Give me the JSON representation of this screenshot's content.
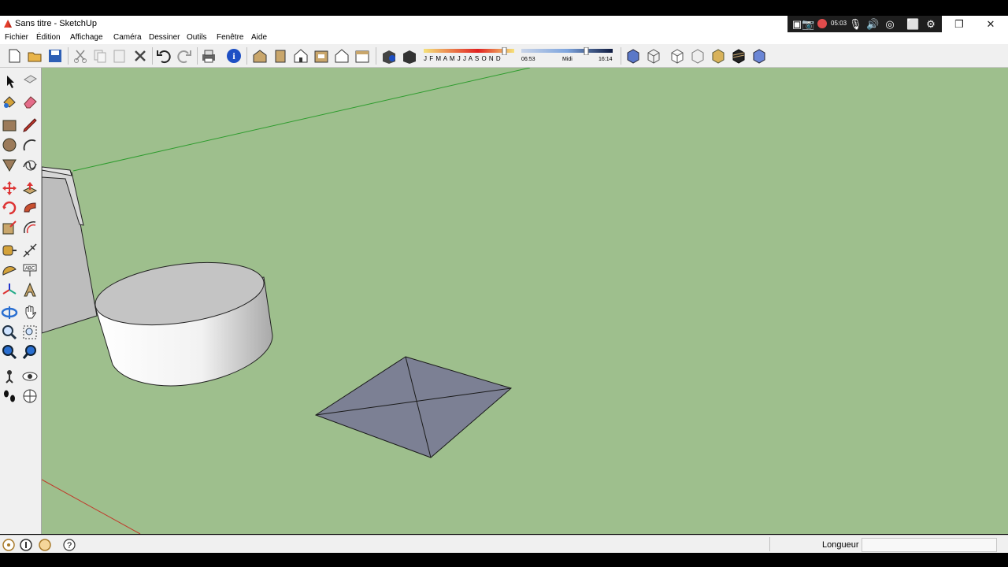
{
  "window": {
    "title": "Sans titre - SketchUp",
    "minimize_glyph": "—",
    "restore_glyph": "❐",
    "close_glyph": "✕"
  },
  "recorder": {
    "time": "05:03",
    "icons": [
      "screenshot-icon",
      "camera-icon",
      "record-icon",
      "microphone-icon",
      "speaker-icon",
      "webcam-icon",
      "fullscreen-icon",
      "settings-icon"
    ]
  },
  "menu": {
    "items": [
      "Fichier",
      "Édition",
      "Affichage",
      "Caméra",
      "Dessiner",
      "Outils",
      "Fenêtre",
      "Aide"
    ]
  },
  "shadows": {
    "months": "J F M A M J J A S O N D",
    "time_start": "06:53",
    "time_mid": "Midi",
    "time_end": "16:14"
  },
  "status": {
    "measure_label": "Longueur",
    "measure_value": "",
    "help_glyph": "?"
  },
  "colors": {
    "background": "#9ebf8d",
    "green_axis": "#2e9c2e",
    "red_axis": "#c03a2b",
    "face_front": "#ffffff",
    "face_top": "#c4c4c4",
    "face_back": "#7c8094"
  }
}
